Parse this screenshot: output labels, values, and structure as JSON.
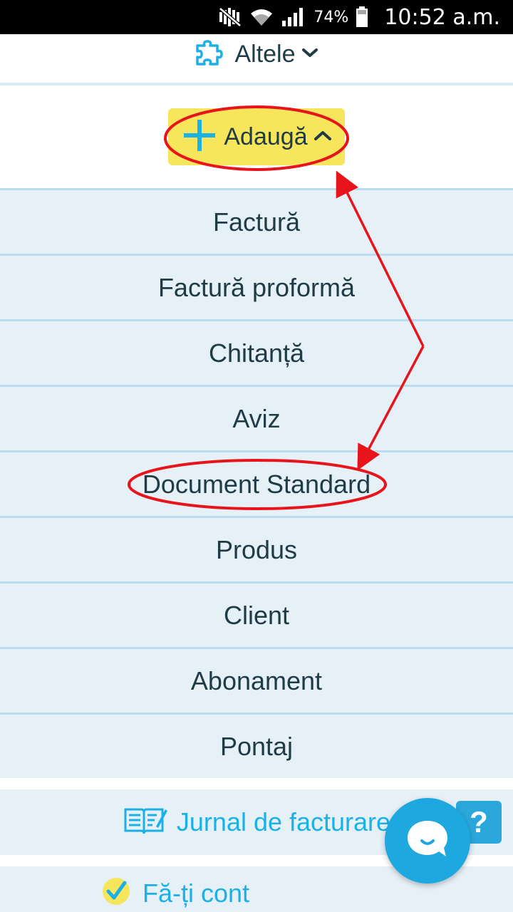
{
  "status_bar": {
    "battery_percent": "74%",
    "time": "10:52 a.m.",
    "icons": [
      "mute-icon",
      "wifi-icon",
      "signal-icon",
      "battery-icon"
    ]
  },
  "top_menu": {
    "label": "Altele",
    "icon": "puzzle-icon"
  },
  "add_button": {
    "label": "Adaugă",
    "icon": "plus-icon"
  },
  "add_menu": {
    "items": [
      "Factură",
      "Factură proformă",
      "Chitanță",
      "Aviz",
      "Document Standard",
      "Produs",
      "Client",
      "Abonament",
      "Pontaj"
    ]
  },
  "jurnal": {
    "label": "Jurnal de facturare",
    "icon": "book-icon"
  },
  "create_account": {
    "label": "Fă-ți cont",
    "icon": "checkmark-icon"
  },
  "help": {
    "label": "?"
  },
  "colors": {
    "accent": "#1bb1e6",
    "button_yellow": "#f7e55b",
    "menu_bg": "#e6f0f7",
    "menu_border": "#b9dcf0",
    "annotation_red": "#e8141c",
    "text_dark": "#1f3b45"
  }
}
